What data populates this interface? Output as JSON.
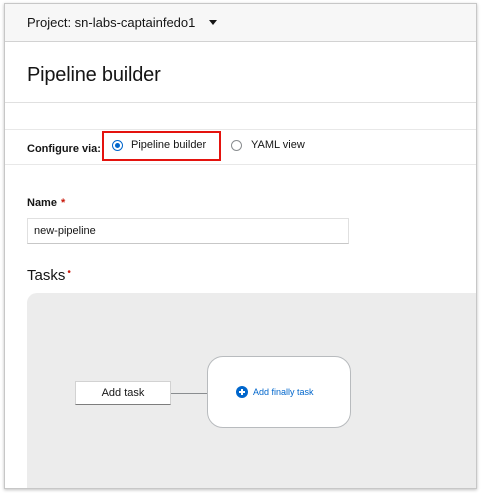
{
  "project_bar": {
    "label": "Project: sn-labs-captainfedo1",
    "dropdown_icon": "caret-down-icon"
  },
  "header": {
    "title": "Pipeline builder"
  },
  "configure": {
    "label": "Configure via:",
    "options": [
      {
        "label": "Pipeline builder",
        "selected": true
      },
      {
        "label": "YAML view",
        "selected": false
      }
    ],
    "highlight_color": "#e4130e"
  },
  "name_field": {
    "label": "Name",
    "required_marker": "*",
    "value": "new-pipeline"
  },
  "tasks": {
    "label": "Tasks",
    "required_marker": "•",
    "add_task_label": "Add task",
    "add_finally_label": "Add finally task",
    "add_finally_icon": "plus-circle-icon"
  },
  "colors": {
    "accent": "#0066cc",
    "required": "#c9190b",
    "canvas_bg": "#ececec"
  }
}
